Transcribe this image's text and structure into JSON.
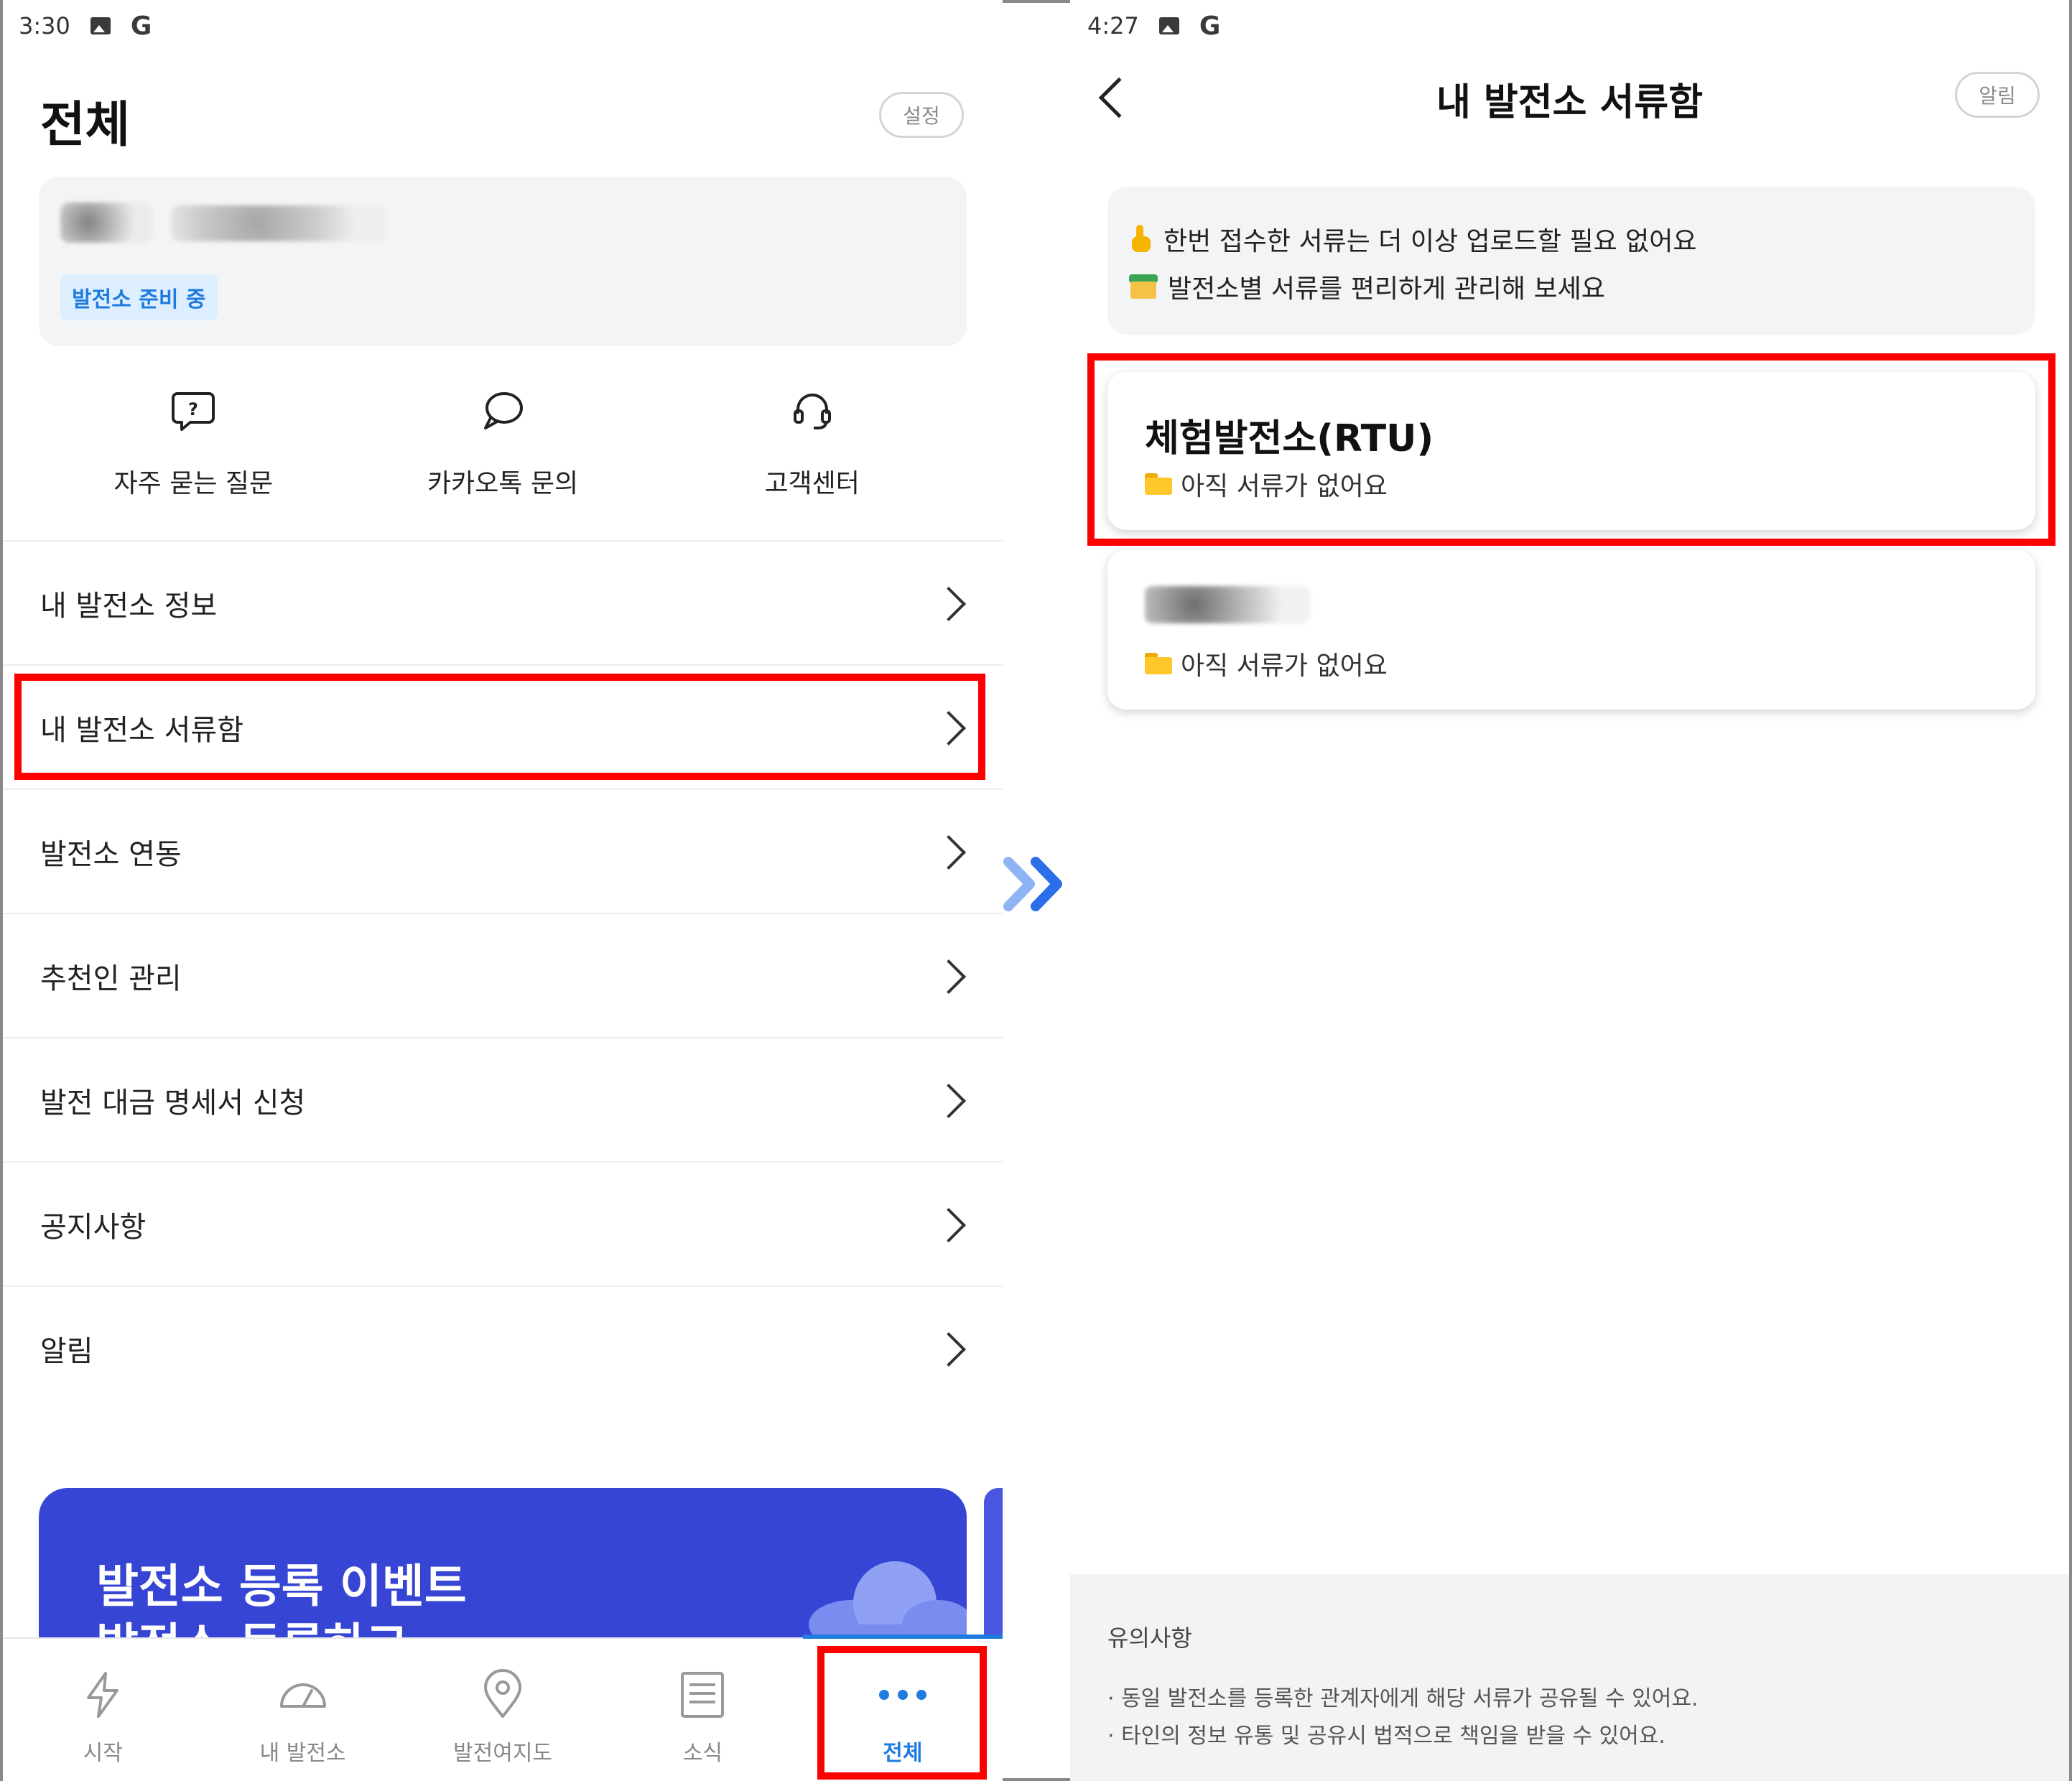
{
  "left": {
    "status_bar": {
      "time": "3:30",
      "icons": [
        "image-icon",
        "google-icon"
      ]
    },
    "page_title": "전체",
    "settings_label": "설정",
    "profile": {
      "badge": "발전소 준비 중"
    },
    "quick_actions": [
      {
        "icon": "faq-icon",
        "label": "자주 묻는 질문"
      },
      {
        "icon": "kakaotalk-icon",
        "label": "카카오톡 문의"
      },
      {
        "icon": "headset-icon",
        "label": "고객센터"
      }
    ],
    "menu": [
      "내 발전소 정보",
      "내 발전소 서류함",
      "발전소 연동",
      "추천인 관리",
      "발전 대금 명세서 신청",
      "공지사항",
      "알림"
    ],
    "banner": {
      "title": "발전소 등록 이벤트",
      "subtitle": "발전소 등록하고"
    },
    "bottom_nav": [
      {
        "icon": "lightning-icon",
        "label": "시작"
      },
      {
        "icon": "gauge-icon",
        "label": "내 발전소"
      },
      {
        "icon": "map-pin-icon",
        "label": "발전여지도"
      },
      {
        "icon": "news-icon",
        "label": "소식"
      },
      {
        "icon": "more-dots-icon",
        "label": "전체",
        "active": true
      }
    ],
    "accent_color": "#1f7be0",
    "banner_color": "#3645d3"
  },
  "right": {
    "status_bar": {
      "time": "4:27",
      "icons": [
        "image-icon",
        "google-icon"
      ]
    },
    "title": "내 발전소 서류함",
    "alarm_label": "알림",
    "info_lines": [
      {
        "icon": "pointing-hand-icon",
        "text": "한번 접수한 서류는 더 이상 업로드할 필요 없어요"
      },
      {
        "icon": "card-box-icon",
        "text": "발전소별 서류를 편리하게 관리해 보세요"
      }
    ],
    "plants": [
      {
        "name": "체험발전소(RTU)",
        "doc_status": "아직 서류가 없어요"
      },
      {
        "doc_status": "아직 서류가 없어요"
      }
    ],
    "notice": {
      "title": "유의사항",
      "items": [
        "· 동일 발전소를 등록한 관계자에게 해당 서류가 공유될 수 있어요.",
        "· 타인의 정보 유통 및 공유시 법적으로 책임을 받을 수 있어요."
      ]
    }
  },
  "highlight_color": "#ff0000"
}
